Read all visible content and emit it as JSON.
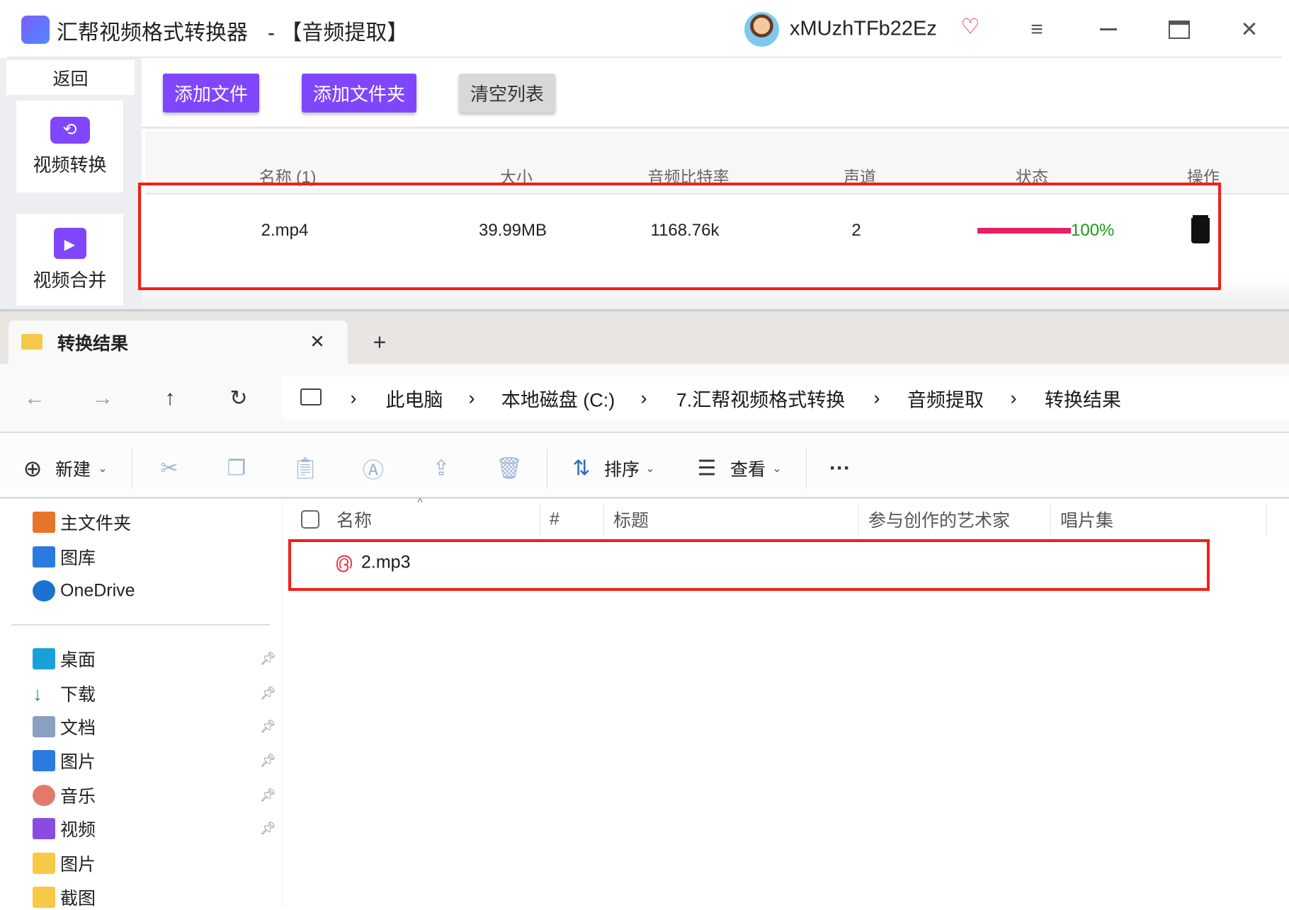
{
  "app": {
    "title": "汇帮视频格式转换器",
    "mode": "-  【音频提取】",
    "username": "xMUzhTFb22Ez",
    "accent": "#8046fb",
    "sidebar": {
      "back": "返回",
      "items": [
        {
          "label": "视频转换",
          "icon": "video-convert-icon"
        },
        {
          "label": "视频合并",
          "icon": "video-merge-icon"
        }
      ]
    },
    "toolbar": {
      "add_file": "添加文件",
      "add_folder": "添加文件夹",
      "clear_list": "清空列表"
    },
    "table": {
      "headers": [
        "名称 (1)",
        "大小",
        "音频比特率",
        "声道",
        "状态",
        "操作"
      ],
      "rows": [
        {
          "name": "2.mp4",
          "size": "39.99MB",
          "bitrate": "1168.76k",
          "channels": "2",
          "progress": 100,
          "progress_label": "100%"
        }
      ]
    },
    "progress_color": "#e91e63",
    "status_color": "#1a9a1a",
    "highlight_color": "#ff0000"
  },
  "explorer": {
    "tab": {
      "title": "转换结果"
    },
    "breadcrumb": [
      "此电脑",
      "本地磁盘 (C:)",
      "7.汇帮视频格式转换",
      "音频提取",
      "转换结果"
    ],
    "toolbar": {
      "new": "新建",
      "sort": "排序",
      "view": "查看",
      "more": "···"
    },
    "nav": {
      "top": [
        {
          "label": "主文件夹",
          "icon": "home-icon"
        },
        {
          "label": "图库",
          "icon": "gallery-icon"
        },
        {
          "label": "OneDrive",
          "icon": "onedrive-icon"
        }
      ],
      "quick": [
        {
          "label": "桌面",
          "icon": "desktop-icon",
          "pinned": true
        },
        {
          "label": "下载",
          "icon": "download-icon",
          "pinned": true
        },
        {
          "label": "文档",
          "icon": "documents-icon",
          "pinned": true
        },
        {
          "label": "图片",
          "icon": "pictures-icon",
          "pinned": true
        },
        {
          "label": "音乐",
          "icon": "music-icon",
          "pinned": true
        },
        {
          "label": "视频",
          "icon": "videos-icon",
          "pinned": true
        },
        {
          "label": "图片",
          "icon": "folder-icon",
          "pinned": false
        },
        {
          "label": "截图",
          "icon": "folder-icon",
          "pinned": false
        }
      ]
    },
    "columns": [
      "名称",
      "#",
      "标题",
      "参与创作的艺术家",
      "唱片集"
    ],
    "files": [
      {
        "name": "2.mp3",
        "icon": "netease-music-icon"
      }
    ]
  }
}
